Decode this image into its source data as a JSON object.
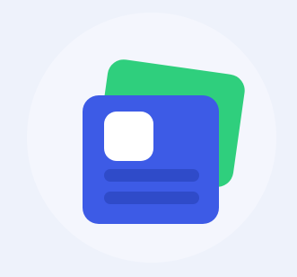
{
  "colors": {
    "background": "#eef2fb",
    "halo": "#f4f6fd",
    "back_card": "#2fcf7d",
    "front_card": "#3d5be6",
    "photo_box": "#ffffff",
    "text_lines": "#2f4bc9"
  },
  "icon": {
    "name": "id-card-stack-icon"
  }
}
